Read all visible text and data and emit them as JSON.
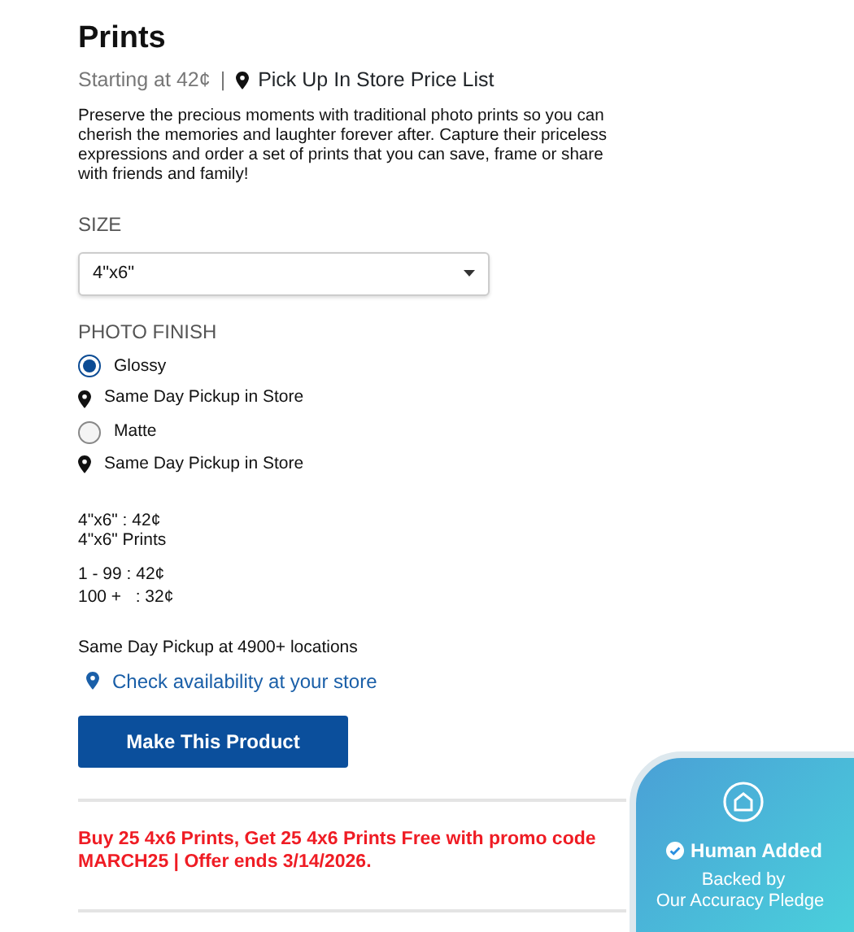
{
  "title": "Prints",
  "starting_price": "Starting at 42¢",
  "separator": "|",
  "price_list_link": "Pick Up In Store Price List",
  "description": "Preserve the precious moments with traditional photo prints so you can cherish the memories and laughter forever after. Capture their priceless expressions and order a set of prints that you can save, frame or share with friends and family!",
  "size": {
    "label": "SIZE",
    "value": "4\"x6\""
  },
  "finish": {
    "label": "PHOTO FINISH",
    "options": [
      {
        "label": "Glossy",
        "note": "Same Day Pickup in Store",
        "selected": true
      },
      {
        "label": "Matte",
        "note": "Same Day Pickup in Store",
        "selected": false
      }
    ]
  },
  "price_summary": [
    "4\"x6\" : 42¢",
    "4\"x6\" Prints"
  ],
  "price_tiers": [
    "1 - 99 : 42¢",
    "100 +   : 32¢"
  ],
  "pickup_note": "Same Day Pickup at 4900+ locations",
  "availability_link": "Check availability at your store",
  "make_button": "Make This Product",
  "promo": "Buy 25 4x6 Prints, Get 25 4x6 Prints Free with promo code MARCH25 | Offer ends 3/14/2026.",
  "badge": {
    "title": "Human Added",
    "subtitle": "Backed by",
    "subtitle_2": "Our Accuracy Pledge"
  }
}
